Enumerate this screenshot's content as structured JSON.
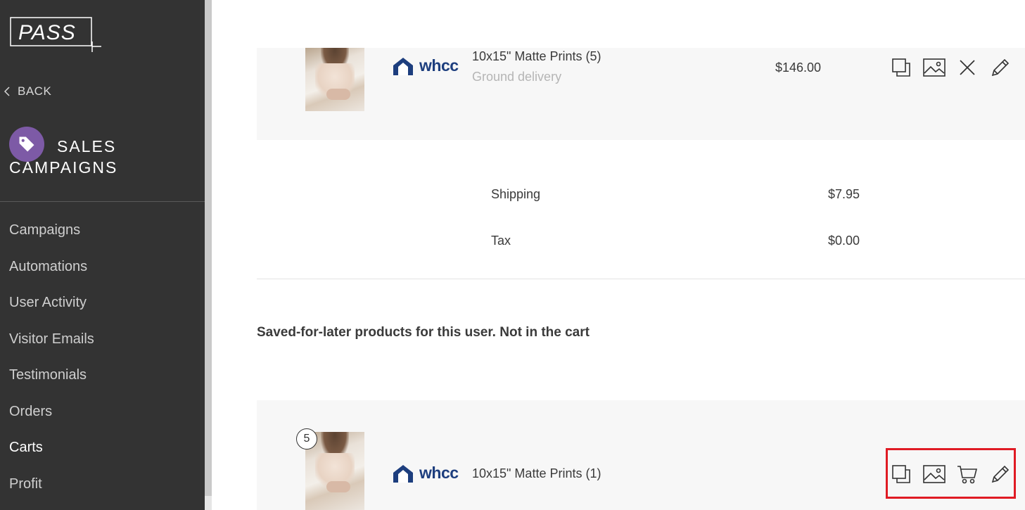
{
  "app": {
    "logo_text": "PASS"
  },
  "sidebar": {
    "back_label": "BACK",
    "section_title_line1": "SALES",
    "section_title_line2": "CAMPAIGNS",
    "items": [
      {
        "label": "Campaigns"
      },
      {
        "label": "Automations"
      },
      {
        "label": "User Activity"
      },
      {
        "label": "Visitor Emails"
      },
      {
        "label": "Testimonials"
      },
      {
        "label": "Orders"
      },
      {
        "label": "Carts",
        "active": true
      },
      {
        "label": "Profit"
      }
    ]
  },
  "cart": {
    "item": {
      "brand": "whcc",
      "title": "10x15\" Matte Prints (5)",
      "subtitle": "Ground delivery",
      "price": "$146.00",
      "actions": [
        "duplicate-icon",
        "image-icon",
        "close-icon",
        "pencil-icon"
      ]
    },
    "summary": [
      {
        "label": "Shipping",
        "value": "$7.95"
      },
      {
        "label": "Tax",
        "value": "$0.00"
      }
    ]
  },
  "saved": {
    "note": "Saved-for-later products for this user. Not in the cart",
    "item": {
      "quantity": "5",
      "brand": "whcc",
      "title": "10x15\" Matte Prints (1)",
      "actions": [
        "duplicate-icon",
        "image-icon",
        "cart-icon",
        "pencil-icon"
      ]
    }
  },
  "colors": {
    "sidebar_bg": "#333333",
    "accent_purple": "#7d5aa6",
    "brand_blue": "#1d3e7e",
    "highlight_red": "#e01b24"
  }
}
